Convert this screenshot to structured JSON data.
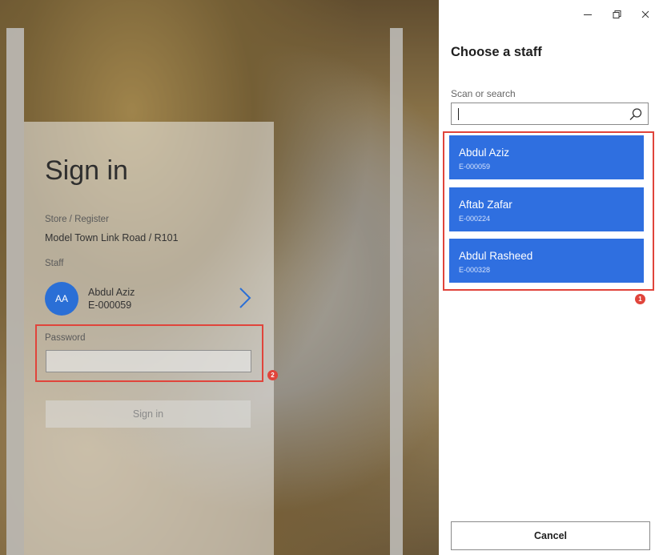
{
  "window": {
    "controls": {
      "minimize_icon": "minimize-icon",
      "restore_icon": "restore-icon",
      "close_icon": "close-icon"
    }
  },
  "signin": {
    "title": "Sign in",
    "store_register_label": "Store / Register",
    "store_register_value": "Model Town Link Road / R101",
    "staff_label": "Staff",
    "staff": {
      "initials": "AA",
      "name": "Abdul Aziz",
      "id": "E-000059"
    },
    "password_label": "Password",
    "password_value": "",
    "signin_button": "Sign in"
  },
  "panel": {
    "title": "Choose a staff",
    "search_label": "Scan or search",
    "search_value": "",
    "staff_list": [
      {
        "name": "Abdul Aziz",
        "id": "E-000059"
      },
      {
        "name": "Aftab Zafar",
        "id": "E-000224"
      },
      {
        "name": "Abdul Rasheed",
        "id": "E-000328"
      }
    ],
    "cancel_button": "Cancel"
  },
  "annotations": {
    "badge_1": "1",
    "badge_2": "2"
  },
  "colors": {
    "accent": "#2f6fe0",
    "avatar": "#2a6fd6",
    "highlight": "#e0443b"
  }
}
